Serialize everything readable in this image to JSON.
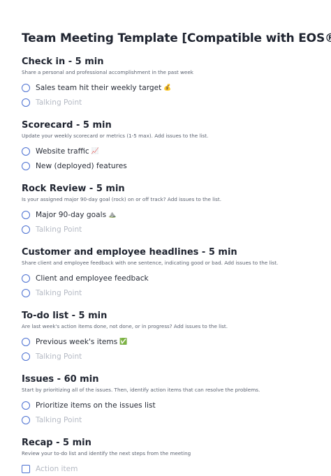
{
  "title": "Team Meeting Template [Compatible with EOS®]",
  "sections": [
    {
      "title": "Check in - 5 min",
      "description": "Share a personal and professional accomplishment in the past week",
      "items": [
        {
          "text": "Sales team hit their weekly target",
          "emoji": "💰",
          "placeholder": false
        },
        {
          "text": "Talking Point",
          "emoji": "",
          "placeholder": true
        }
      ]
    },
    {
      "title": "Scorecard - 5 min",
      "description": "Update your weekly scorecard or metrics (1-5 max). Add issues to the list.",
      "items": [
        {
          "text": "Website traffic",
          "emoji": "📈",
          "placeholder": false
        },
        {
          "text": "New (deployed) features",
          "emoji": "",
          "placeholder": false
        }
      ]
    },
    {
      "title": "Rock Review - 5 min",
      "description": "Is your assigned major 90-day goal (rock) on or off track? Add issues to the list.",
      "items": [
        {
          "text": "Major 90-day goals",
          "emoji": "⛰️",
          "placeholder": false
        },
        {
          "text": "Talking Point",
          "emoji": "",
          "placeholder": true
        }
      ]
    },
    {
      "title": "Customer and employee headlines - 5 min",
      "description": "Share client and employee feedback with one sentence, indicating good or bad. Add issues to the list.",
      "items": [
        {
          "text": "Client and employee feedback",
          "emoji": "",
          "placeholder": false
        },
        {
          "text": "Talking Point",
          "emoji": "",
          "placeholder": true
        }
      ]
    },
    {
      "title": "To-do list - 5 min",
      "description": "Are last week's action items done, not done, or in progress? Add issues to the list.",
      "items": [
        {
          "text": "Previous week's items",
          "emoji": "✅",
          "placeholder": false
        },
        {
          "text": "Talking Point",
          "emoji": "",
          "placeholder": true
        }
      ]
    },
    {
      "title": "Issues - 60 min",
      "description": "Start by prioritizing all of the issues. Then, identify action items that can resolve the problems.",
      "items": [
        {
          "text": "Prioritize items on the issues list",
          "emoji": "",
          "placeholder": false
        },
        {
          "text": "Talking Point",
          "emoji": "",
          "placeholder": true
        }
      ]
    },
    {
      "title": "Recap - 5 min",
      "description": "Review your to-do list and identify the next steps from the meeting",
      "items": [
        {
          "text": "Action item",
          "emoji": "",
          "placeholder": true,
          "checkbox": true
        }
      ]
    }
  ],
  "colors": {
    "accent": "#4a6fd1",
    "placeholder": "#b5bac4"
  }
}
